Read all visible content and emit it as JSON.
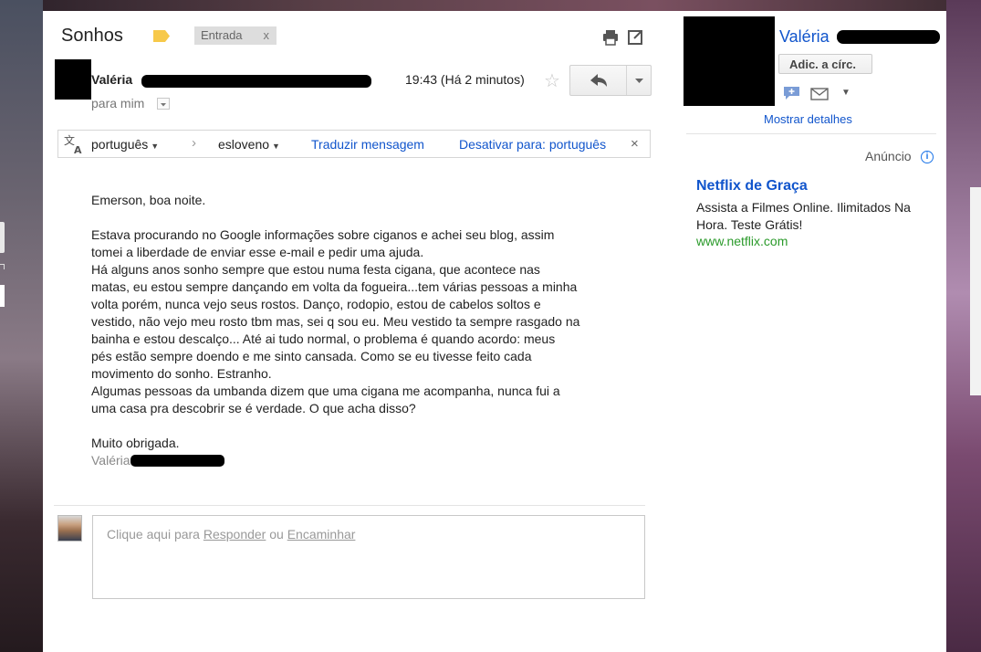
{
  "email": {
    "subject": "Sonhos",
    "inbox_label": "Entrada",
    "inbox_label_remove": "x",
    "sender_name": "Valéria",
    "time": "19:43 (Há 2 minutos)",
    "to_me": "para mim"
  },
  "translate": {
    "from_lang": "português",
    "to_lang": "esloveno",
    "translate_link": "Traduzir mensagem",
    "disable_link": "Desativar para: português",
    "close": "×"
  },
  "body": {
    "greeting": "Emerson, boa noite.",
    "lines": [
      "Estava procurando no Google informações sobre ciganos e achei seu blog, assim",
      "tomei a liberdade de enviar esse e-mail e pedir uma ajuda.",
      "Há alguns anos sonho sempre que estou numa festa cigana, que acontece nas",
      "matas, eu estou sempre dançando em volta da fogueira...tem várias pessoas a minha",
      "volta porém,  nunca vejo seus rostos. Danço,  rodopio, estou de cabelos soltos e",
      "vestido, não vejo meu rosto tbm mas, sei q sou eu. Meu vestido ta sempre rasgado na",
      "bainha e estou descalço... Até ai tudo normal,  o problema é quando acordo: meus",
      "pés estão sempre doendo e me sinto cansada. Como se eu tivesse feito cada",
      "movimento do sonho. Estranho.",
      "Algumas pessoas da umbanda dizem que uma cigana me acompanha, nunca fui a",
      "uma casa pra descobrir se é verdade.  O que acha disso?"
    ],
    "closing": "Muito obrigada.",
    "signature": "Valéria"
  },
  "reply": {
    "prompt_prefix": "Clique aqui para ",
    "reply_link": "Responder",
    "or": " ou ",
    "forward_link": "Encaminhar"
  },
  "sidebar": {
    "contact_name": "Valéria",
    "add_circle": "Adic. a círc.",
    "show_details": "Mostrar detalhes",
    "ad_label": "Anúncio",
    "ad_title": "Netflix de Graça",
    "ad_text": "Assista a Filmes Online. Ilimitados Na Hora. Teste Grátis!",
    "ad_url": "www.netflix.com"
  },
  "colors": {
    "link": "#1155cc",
    "ad_url": "#2a9a2a",
    "label_tag": "#f7c94a"
  }
}
